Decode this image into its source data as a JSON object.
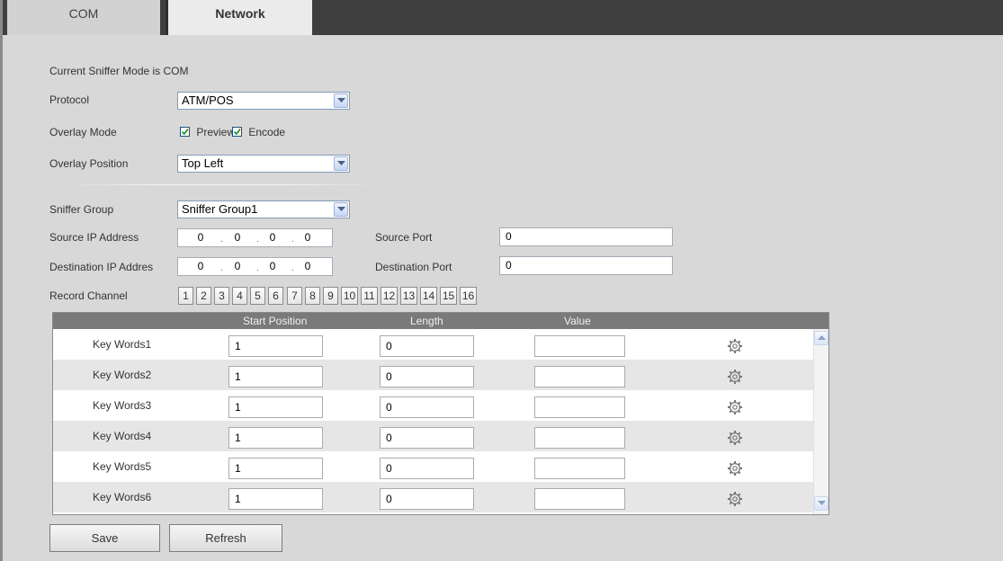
{
  "tabs": [
    {
      "label": "COM",
      "active": false
    },
    {
      "label": "Network",
      "active": true
    }
  ],
  "status_text": "Current Sniffer Mode is COM",
  "protocol": {
    "label": "Protocol",
    "value": "ATM/POS"
  },
  "overlay_mode": {
    "label": "Overlay Mode",
    "preview_label": "Preview",
    "preview_checked": true,
    "encode_label": "Encode",
    "encode_checked": true
  },
  "overlay_position": {
    "label": "Overlay Position",
    "value": "Top Left"
  },
  "sniffer_group": {
    "label": "Sniffer Group",
    "value": "Sniffer Group1"
  },
  "source_ip": {
    "label": "Source IP Address",
    "octets": [
      "0",
      "0",
      "0",
      "0"
    ]
  },
  "source_port": {
    "label": "Source Port",
    "value": "0"
  },
  "dest_ip": {
    "label": "Destination IP Addres",
    "octets": [
      "0",
      "0",
      "0",
      "0"
    ]
  },
  "dest_port": {
    "label": "Destination Port",
    "value": "0"
  },
  "record_channel": {
    "label": "Record Channel",
    "channels": [
      "1",
      "2",
      "3",
      "4",
      "5",
      "6",
      "7",
      "8",
      "9",
      "10",
      "11",
      "12",
      "13",
      "14",
      "15",
      "16"
    ]
  },
  "keywords_table": {
    "headers": {
      "start": "Start Position",
      "length": "Length",
      "value": "Value"
    },
    "rows": [
      {
        "name": "Key Words1",
        "start": "1",
        "length": "0",
        "value": ""
      },
      {
        "name": "Key Words2",
        "start": "1",
        "length": "0",
        "value": ""
      },
      {
        "name": "Key Words3",
        "start": "1",
        "length": "0",
        "value": ""
      },
      {
        "name": "Key Words4",
        "start": "1",
        "length": "0",
        "value": ""
      },
      {
        "name": "Key Words5",
        "start": "1",
        "length": "0",
        "value": ""
      },
      {
        "name": "Key Words6",
        "start": "1",
        "length": "0",
        "value": ""
      }
    ],
    "row_icon": "gear-icon"
  },
  "buttons": {
    "save": "Save",
    "refresh": "Refresh"
  },
  "colors": {
    "tabbar": "#3f3f3f",
    "panel": "#d8d8d8",
    "grid_header": "#7a7a7a",
    "alt_row": "#e6e6e6"
  }
}
